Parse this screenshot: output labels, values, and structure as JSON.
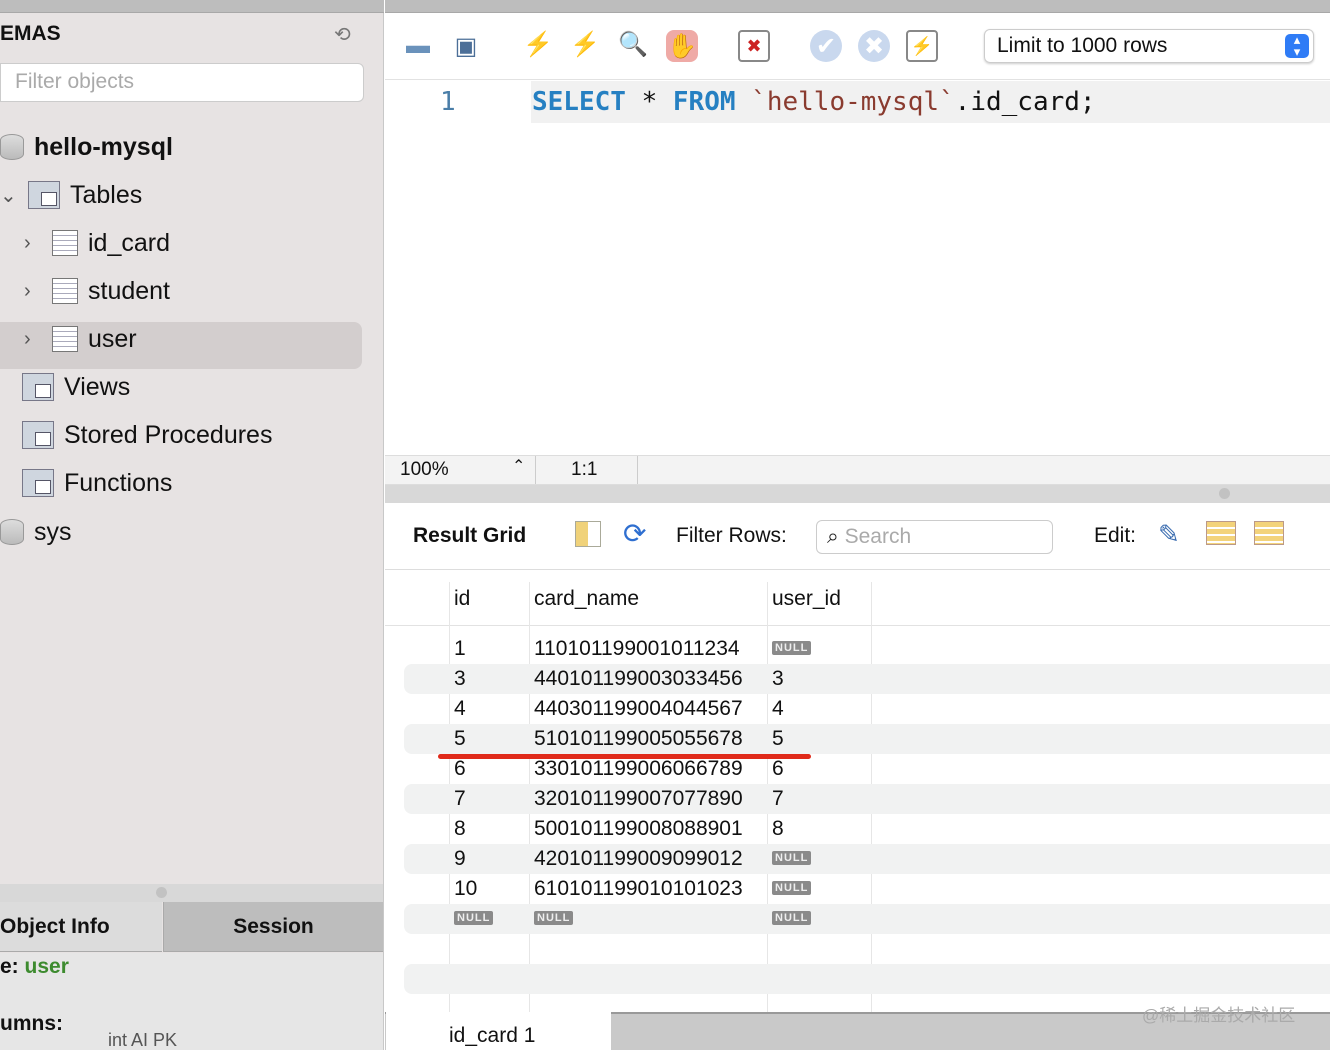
{
  "sidebar": {
    "header": "EMAS",
    "filter_placeholder": "Filter objects",
    "schema": "hello-mysql",
    "tables_label": "Tables",
    "tables": [
      "id_card",
      "student",
      "user"
    ],
    "views": "Views",
    "procedures": "Stored Procedures",
    "functions": "Functions",
    "other_schema": "sys",
    "tabs": [
      "Object Info",
      "Session"
    ],
    "info_table_label": "e:",
    "info_table_value": "user",
    "info_columns_label": "umns:",
    "info_partial": "int AI PK"
  },
  "toolbar": {
    "limit": "Limit to 1000 rows"
  },
  "editor": {
    "line": "1",
    "kw1": "SELECT",
    "star": "*",
    "kw2": "FROM",
    "table": "`hello-mysql`",
    "rest": ".id_card;"
  },
  "status": {
    "zoom": "100%",
    "position": "1:1"
  },
  "result": {
    "title": "Result Grid",
    "filter_label": "Filter Rows:",
    "search_placeholder": "Search",
    "edit_label": "Edit:",
    "columns": [
      "id",
      "card_name",
      "user_id"
    ],
    "rows": [
      [
        "1",
        "110101199001011234",
        "NULL"
      ],
      [
        "3",
        "440101199003033456",
        "3"
      ],
      [
        "4",
        "440301199004044567",
        "4"
      ],
      [
        "5",
        "510101199005055678",
        "5"
      ],
      [
        "6",
        "330101199006066789",
        "6"
      ],
      [
        "7",
        "320101199007077890",
        "7"
      ],
      [
        "8",
        "500101199008088901",
        "8"
      ],
      [
        "9",
        "420101199009099012",
        "NULL"
      ],
      [
        "10",
        "610101199010101023",
        "NULL"
      ],
      [
        "NULL",
        "NULL",
        "NULL"
      ]
    ],
    "tab": "id_card 1"
  },
  "watermark": "@稀土掘金技术社区",
  "colors": {
    "keyword": "#2680c2",
    "highlight": "#e02a1a",
    "accent": "#2f7cf6",
    "green": "#3d8b2f"
  }
}
